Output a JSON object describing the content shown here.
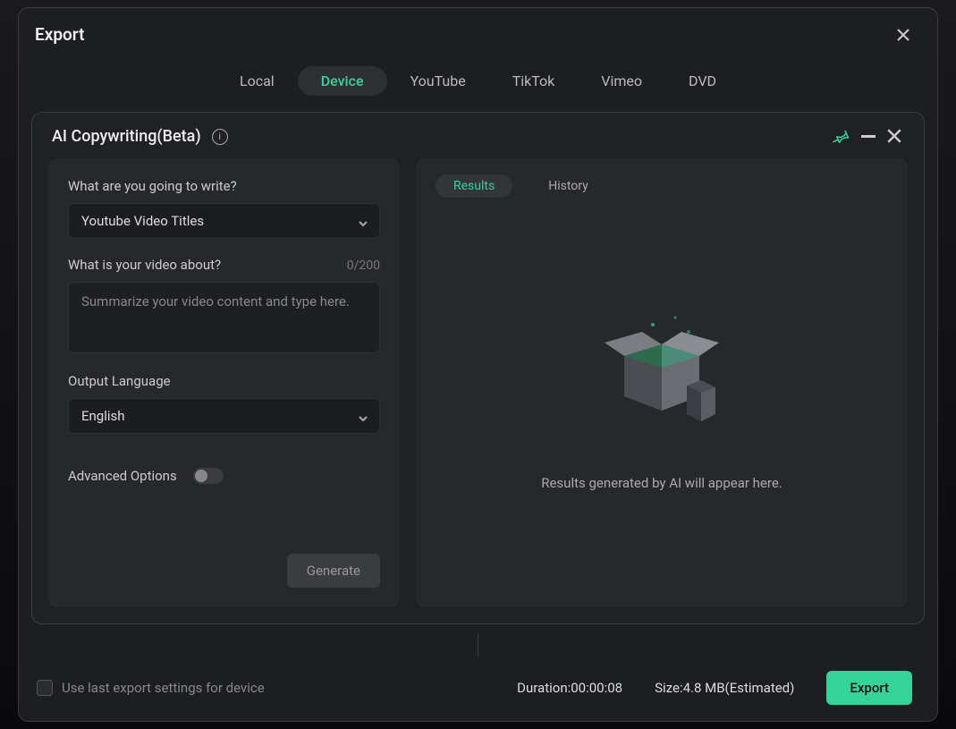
{
  "header": {
    "title": "Export"
  },
  "tabs": {
    "items": [
      {
        "label": "Local"
      },
      {
        "label": "Device"
      },
      {
        "label": "YouTube"
      },
      {
        "label": "TikTok"
      },
      {
        "label": "Vimeo"
      },
      {
        "label": "DVD"
      }
    ],
    "active_index": 1
  },
  "ai_panel": {
    "title": "AI Copywriting(Beta)",
    "prompt_label": "What are you going to write?",
    "prompt_select_value": "Youtube Video Titles",
    "about_label": "What is your video about?",
    "about_counter": "0/200",
    "about_placeholder": "Summarize your video content and type here.",
    "lang_label": "Output Language",
    "lang_value": "English",
    "adv_label": "Advanced Options",
    "generate_label": "Generate",
    "results_tab": "Results",
    "history_tab": "History",
    "empty_text": "Results generated by AI will appear here."
  },
  "footer": {
    "checkbox_label": "Use last export settings for device",
    "duration_label": "Duration:",
    "duration_value": "00:00:08",
    "size_label": "Size:",
    "size_value": "4.8 MB(Estimated)",
    "export_label": "Export"
  },
  "icons": {
    "pin": "pin-icon",
    "info": "info-icon"
  }
}
